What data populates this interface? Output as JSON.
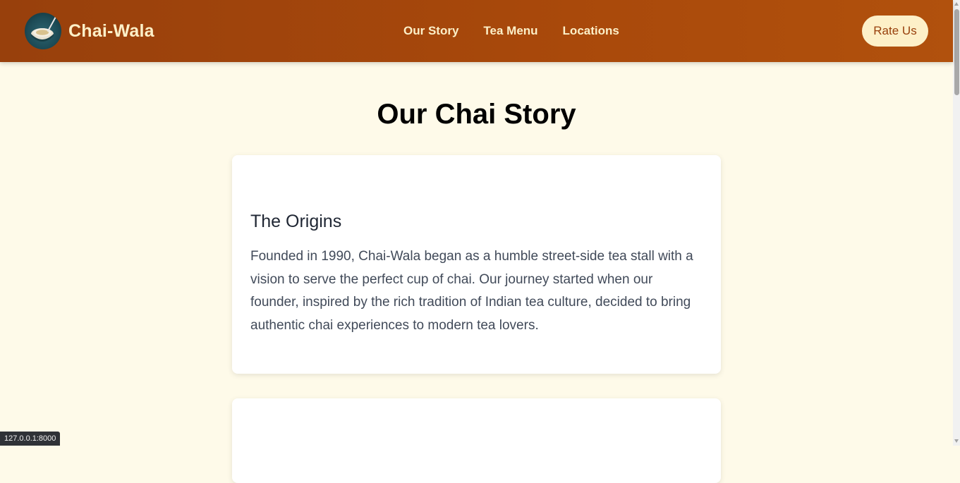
{
  "header": {
    "brand_name": "Chai-Wala",
    "logo_icon": "chai-cup-icon",
    "nav": [
      {
        "label": "Our Story"
      },
      {
        "label": "Tea Menu"
      },
      {
        "label": "Locations"
      }
    ],
    "rate_button_label": "Rate Us"
  },
  "main": {
    "page_title": "Our Chai Story",
    "sections": [
      {
        "title": "The Origins",
        "text": "Founded in 1990, Chai-Wala began as a humble street-side tea stall with a vision to serve the perfect cup of chai. Our journey started when our founder, inspired by the rich tradition of Indian tea culture, decided to bring authentic chai experiences to modern tea lovers."
      }
    ]
  },
  "browser": {
    "status_url": "127.0.0.1:8000"
  },
  "colors": {
    "header_start": "#98400c",
    "header_end": "#b1510d",
    "cream": "#fdf0c8",
    "page_background": "#fefae9"
  }
}
